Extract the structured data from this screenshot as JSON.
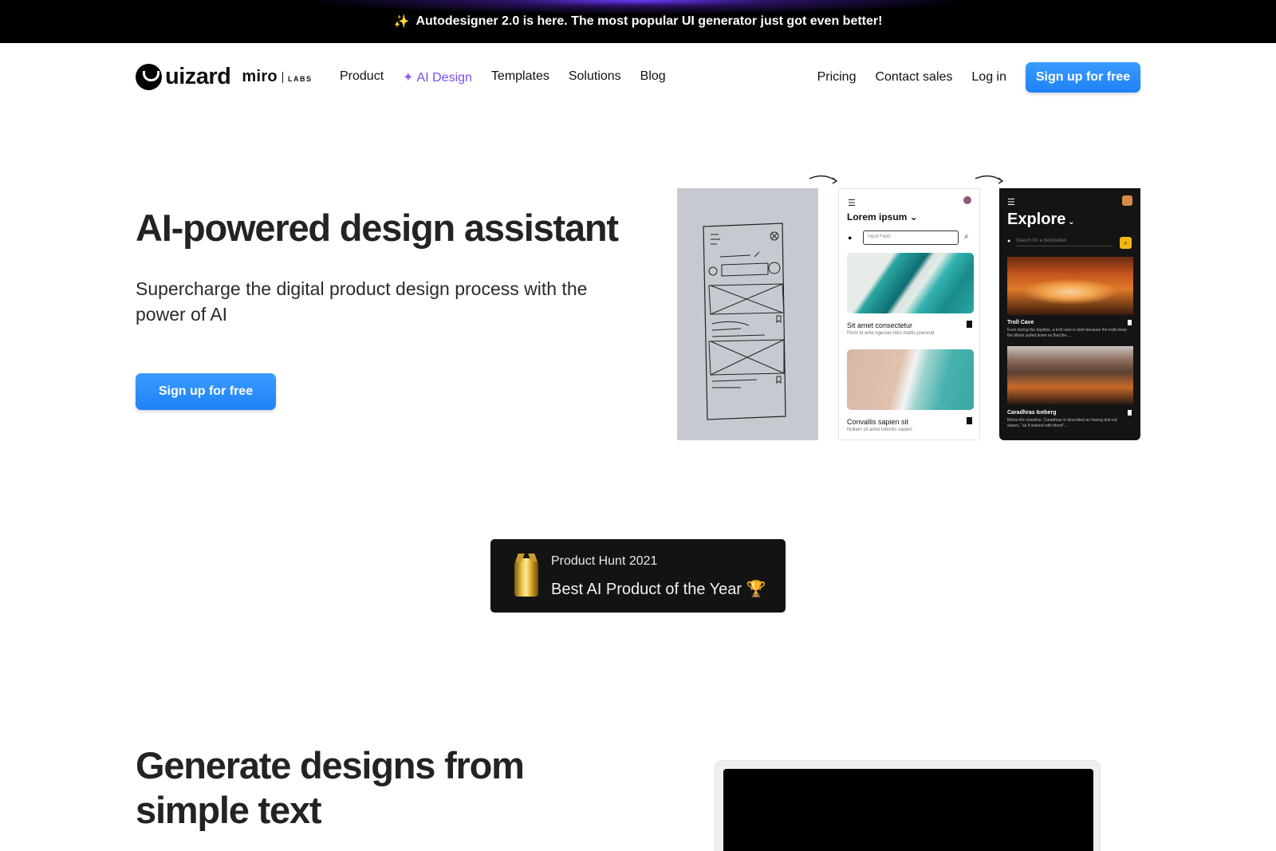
{
  "announcement": {
    "icon": "sparkle-icon",
    "text": "Autodesigner 2.0 is here. The most popular UI generator just got even better!"
  },
  "brand": {
    "logo_text": "uizard",
    "partner": "miro",
    "partner_suffix": "LABS"
  },
  "nav": {
    "links": [
      "Product",
      "AI Design",
      "Templates",
      "Solutions",
      "Blog"
    ],
    "right_links": [
      "Pricing",
      "Contact sales",
      "Log in"
    ],
    "cta": "Sign up for free",
    "accent_color": "#7a4cf0",
    "button_color": "#2b8cff"
  },
  "hero": {
    "title": "AI-powered design assistant",
    "subtitle": "Supercharge the digital product design process with the power of AI",
    "cta": "Sign up for free"
  },
  "mockups": {
    "light": {
      "title": "Lorem ipsum",
      "input_placeholder": "Input Field",
      "card1_title": "Sit amet consectetur",
      "card1_sub": "Proin id ante egestas felis mattis placerat",
      "card2_title": "Convallis sapien sit",
      "card2_sub": "Nullam sit amet lobortis sapien"
    },
    "dark": {
      "title": "Explore",
      "search_placeholder": "Search for a destination",
      "card1_title": "Troll Cave",
      "card1_sub": "Even during the daytime, a troll cave is dark because the trolls keep the blinds pulled down so that the ...",
      "card2_title": "Caradhras Iceberg",
      "card2_sub": "Below the snowline, Caradhras is described as having dull red slopes, \"as if stained with blood\"..."
    }
  },
  "award": {
    "year_label": "Product Hunt 2021",
    "title": "Best AI Product of the Year 🏆"
  },
  "section2": {
    "title": "Generate designs from simple text"
  }
}
